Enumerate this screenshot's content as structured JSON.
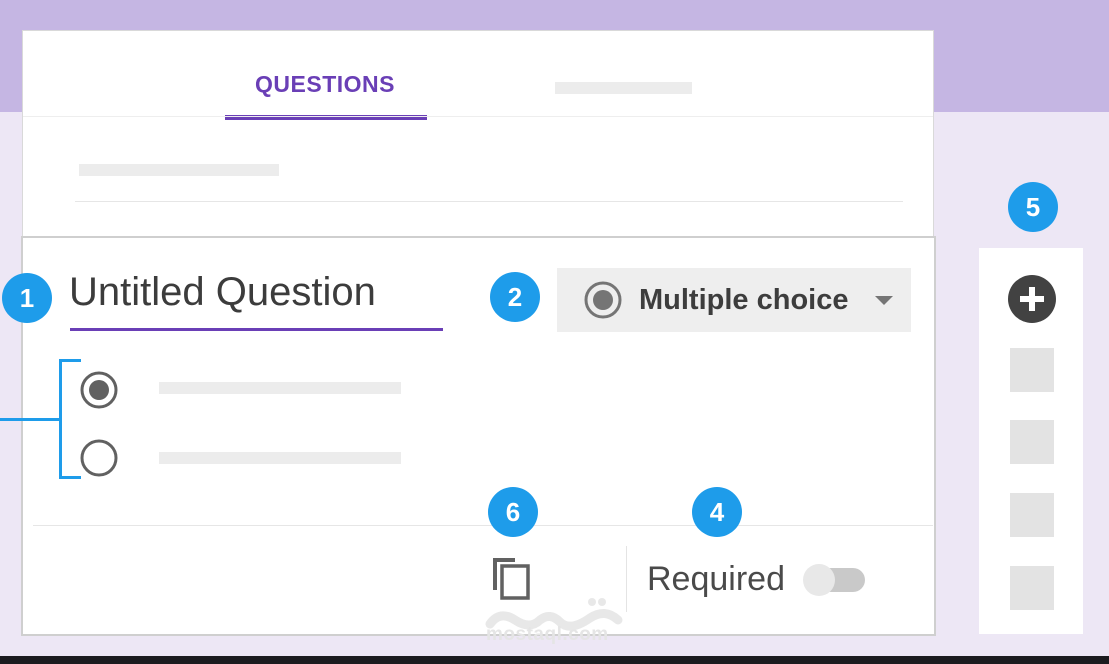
{
  "colors": {
    "accent": "#6a3fb6",
    "badge": "#1e9cea",
    "header_band": "#c5b6e3",
    "background": "#ede7f5"
  },
  "tabs": {
    "questions_label": "QUESTIONS",
    "active": "QUESTIONS"
  },
  "question": {
    "title": "Untitled Question",
    "type_label": "Multiple choice",
    "type_icon": "radio-checked-icon",
    "options": [
      {
        "selected": true
      },
      {
        "selected": false
      }
    ],
    "required_label": "Required",
    "required_on": false
  },
  "toolbar": {
    "add_icon": "add-circle-icon"
  },
  "callouts": {
    "one": "1",
    "two": "2",
    "four": "4",
    "five": "5",
    "six": "6"
  },
  "watermark": {
    "text": "mostaql.com",
    "logo_text": "مستقل"
  }
}
